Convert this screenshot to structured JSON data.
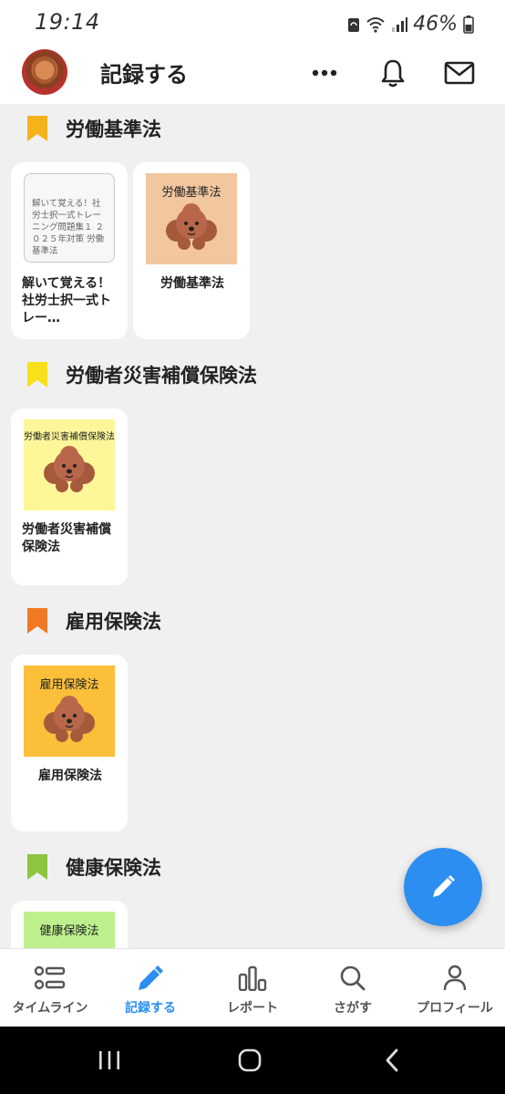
{
  "status_bar": {
    "time": "19:14",
    "battery_percent": "46%"
  },
  "header": {
    "title": "記録する",
    "icons": [
      "more-icon",
      "bell-icon",
      "mail-icon"
    ]
  },
  "sections": [
    {
      "title": "労働基準法",
      "color": "#f5b21a",
      "cards": [
        {
          "thumb_text": "解いて覚える！社労士択一式トレーニング問題集１ ２０２５年対策 労働基準法",
          "label": "解いて覚える！社労士択一式トレー…"
        },
        {
          "thumb_caption": "労働基準法",
          "label": "労働基準法",
          "thumb_bg": "#f2c79f"
        }
      ]
    },
    {
      "title": "労働者災害補償保険法",
      "color": "#f7e11b",
      "cards": [
        {
          "thumb_caption": "労働者災害補償保険法",
          "label": "労働者災害補償保険法",
          "thumb_bg": "#fef79a"
        }
      ]
    },
    {
      "title": "雇用保険法",
      "color": "#f07a24",
      "cards": [
        {
          "thumb_caption": "雇用保険法",
          "label": "雇用保険法",
          "thumb_bg": "#fbbf3a"
        }
      ]
    },
    {
      "title": "健康保険法",
      "color": "#8cc63e",
      "cards": [
        {
          "thumb_caption": "健康保険法",
          "thumb_bg": "#bdf08c"
        }
      ]
    }
  ],
  "fab": {
    "icon": "pencil-icon"
  },
  "bottom_nav": [
    {
      "label": "タイムライン",
      "icon": "timeline-icon"
    },
    {
      "label": "記録する",
      "icon": "pencil-icon",
      "active": true
    },
    {
      "label": "レポート",
      "icon": "bar-chart-icon"
    },
    {
      "label": "さがす",
      "icon": "search-icon"
    },
    {
      "label": "プロフィール",
      "icon": "person-icon"
    }
  ],
  "colors": {
    "accent": "#2c8ef0",
    "background": "#f0f0f0"
  }
}
